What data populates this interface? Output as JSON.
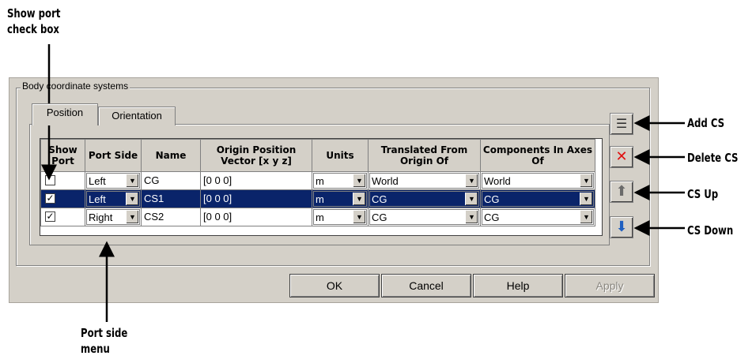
{
  "annotations": {
    "show_port_checkbox": [
      "Show port",
      "check box"
    ],
    "add_cs": "Add CS",
    "delete_cs": "Delete CS",
    "cs_up": "CS Up",
    "cs_down": "CS Down",
    "port_side_menu": [
      "Port side",
      "menu"
    ]
  },
  "dialog": {
    "group_label": "Body coordinate systems",
    "tabs": [
      {
        "label": "Position",
        "active": true
      },
      {
        "label": "Orientation",
        "active": false
      }
    ],
    "columns": [
      "Show Port",
      "Port Side",
      "Name",
      "Origin Position Vector [x y z]",
      "Units",
      "Translated From Origin Of",
      "Components In Axes Of"
    ],
    "rows": [
      {
        "show_port": false,
        "port_side": "Left",
        "name": "CG",
        "origin": "[0 0 0]",
        "units": "m",
        "translated_from": "World",
        "components_in": "World",
        "selected": false
      },
      {
        "show_port": true,
        "port_side": "Left",
        "name": "CS1",
        "origin": "[0 0 0]",
        "units": "m",
        "translated_from": "CG",
        "components_in": "CG",
        "selected": true
      },
      {
        "show_port": true,
        "port_side": "Right",
        "name": "CS2",
        "origin": "[0 0 0]",
        "units": "m",
        "translated_from": "CG",
        "components_in": "CG",
        "selected": false
      }
    ],
    "side_buttons": [
      {
        "name": "add-cs-button",
        "icon": "add-row-icon",
        "glyph": "☰"
      },
      {
        "name": "delete-cs-button",
        "icon": "red-x-icon",
        "glyph": "✕",
        "color": "#e01010"
      },
      {
        "name": "cs-up-button",
        "icon": "arrow-up-icon",
        "glyph": "⬆",
        "color": "#6a6a6a"
      },
      {
        "name": "cs-down-button",
        "icon": "arrow-down-icon",
        "glyph": "⬇",
        "color": "#1f5fc0"
      }
    ],
    "buttons": {
      "ok": "OK",
      "cancel": "Cancel",
      "help": "Help",
      "apply": "Apply"
    },
    "dropdown_arrow": "▼",
    "check_mark": "✓",
    "colors": {
      "selection": "#0a246a",
      "dialog_bg": "#d4d0c8"
    }
  }
}
